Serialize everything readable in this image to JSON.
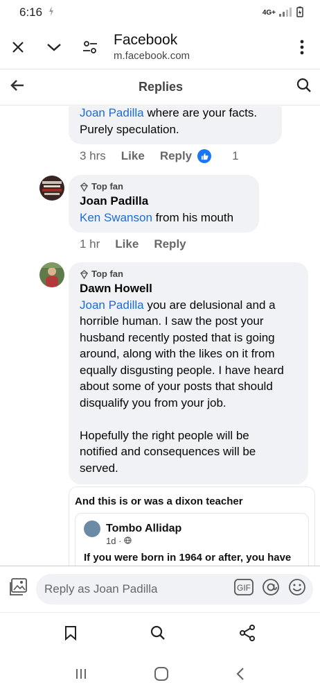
{
  "status_bar": {
    "time": "6:16",
    "network": "4G+"
  },
  "browser": {
    "title": "Facebook",
    "url": "m.facebook.com"
  },
  "header": {
    "title": "Replies"
  },
  "comments": [
    {
      "mention": "Joan Padilla",
      "text_line1": " where are your facts.",
      "text_line2": "Purely speculation.",
      "time": "3 hrs",
      "like_label": "Like",
      "reply_label": "Reply",
      "reaction_count": "1"
    },
    {
      "badge": "Top fan",
      "author": "Joan Padilla",
      "mention": "Ken Swanson",
      "text": " from his mouth",
      "time": "1 hr",
      "like_label": "Like",
      "reply_label": "Reply"
    },
    {
      "badge": "Top fan",
      "author": "Dawn Howell",
      "mention": "Joan Padilla",
      "lines": [
        " you are delusional and a",
        "horrible human.  I saw the post your",
        "husband recently posted that is going",
        "around, along with the likes on it from",
        "equally disgusting people.  I have heard",
        "about some of your posts that should",
        "disqualify you from your job."
      ],
      "lines2": [
        "Hopefully the right people will be",
        "notified and consequences will be",
        "served."
      ]
    }
  ],
  "shared_post": {
    "caption": "And this is or was a dixon teacher",
    "author": "Tombo Allidap",
    "time": "1d ·",
    "text": "If you were born in 1964 or after, you have"
  },
  "reply_bar": {
    "placeholder": "Reply as Joan Padilla",
    "gif_label": "GIF"
  },
  "colors": {
    "accent": "#1877f2",
    "mention": "#1b6bd8",
    "bubble": "#f0f2f5"
  }
}
